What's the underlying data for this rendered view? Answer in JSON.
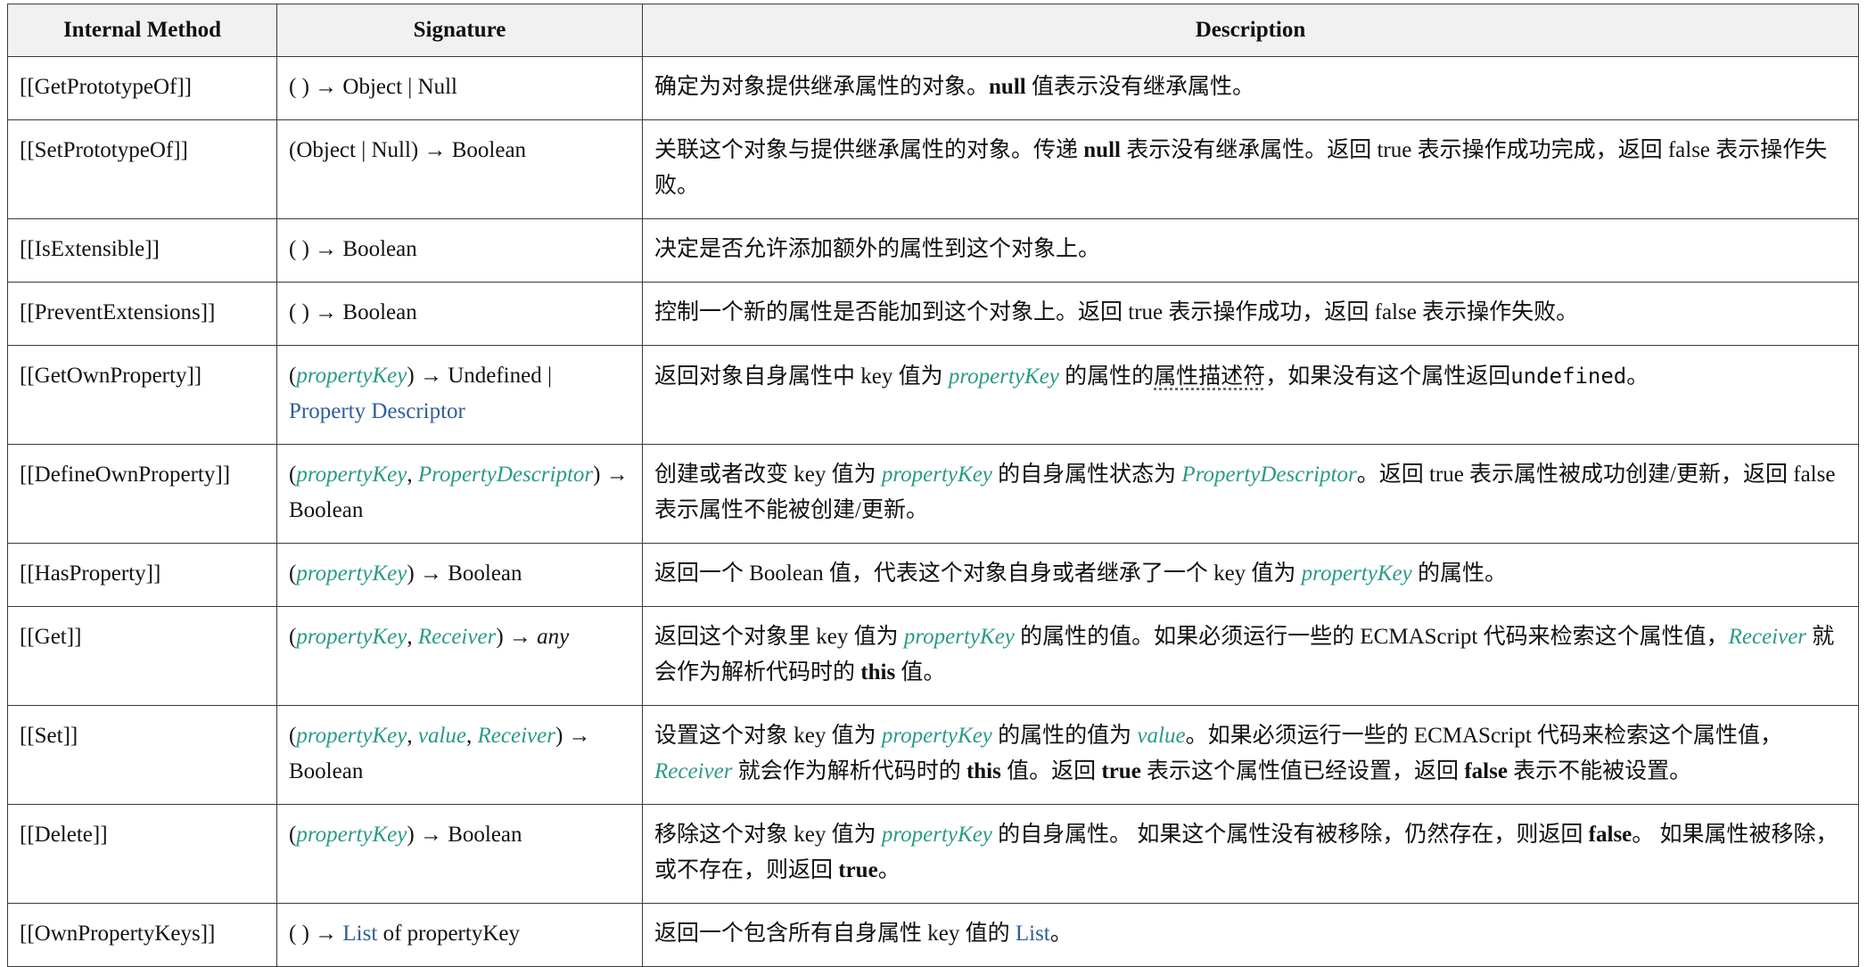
{
  "headers": {
    "method": "Internal Method",
    "signature": "Signature",
    "description": "Description"
  },
  "rows": [
    {
      "method": "[[GetPrototypeOf]]",
      "sig": [
        "( ) → Object | Null"
      ],
      "desc": [
        "确定为对象提供继承属性的对象。",
        "null",
        " 值表示没有继承属性。"
      ]
    },
    {
      "method": "[[SetPrototypeOf]]",
      "sig": [
        "(Object | Null) → Boolean"
      ],
      "desc": [
        "关联这个对象与提供继承属性的对象。传递 ",
        "null",
        " 表示没有继承属性。返回 true 表示操作成功完成，返回 false 表示操作失败。"
      ]
    },
    {
      "method": "[[IsExtensible]]",
      "sig": [
        "( ) → Boolean"
      ],
      "desc": [
        "决定是否允许添加额外的属性到这个对象上。"
      ]
    },
    {
      "method": "[[PreventExtensions]]",
      "sig": [
        "( ) → Boolean"
      ],
      "desc": [
        "控制一个新的属性是否能加到这个对象上。返回 true 表示操作成功，返回 false 表示操作失败。"
      ]
    },
    {
      "method": "[[GetOwnProperty]]",
      "sig": [
        "(",
        "propertyKey",
        ") → Undefined | ",
        "Property Descriptor"
      ],
      "desc": [
        "返回对象自身属性中 key 值为 ",
        "propertyKey",
        " 的属性的",
        "属性描述符",
        "，如果没有这个属性返回",
        "undefined",
        "。"
      ]
    },
    {
      "method": "[[DefineOwnProperty]]",
      "sig": [
        "(",
        "propertyKey",
        ", ",
        "PropertyDescriptor",
        ") → Boolean"
      ],
      "desc": [
        "创建或者改变 key 值为 ",
        "propertyKey",
        " 的自身属性状态为 ",
        "PropertyDescriptor",
        "。返回 true 表示属性被成功创建/更新，返回 false 表示属性不能被创建/更新。"
      ]
    },
    {
      "method": "[[HasProperty]]",
      "sig": [
        "(",
        "propertyKey",
        ") → Boolean"
      ],
      "desc": [
        "返回一个 Boolean 值，代表这个对象自身或者继承了一个 key 值为 ",
        "propertyKey",
        " 的属性。"
      ]
    },
    {
      "method": "[[Get]]",
      "sig": [
        "(",
        "propertyKey",
        ", ",
        "Receiver",
        ") → ",
        "any"
      ],
      "desc": [
        "返回这个对象里 key 值为 ",
        "propertyKey",
        " 的属性的值。如果必须运行一些的 ECMAScript 代码来检索这个属性值，",
        "Receiver",
        " 就会作为解析代码时的 ",
        "this",
        " 值。"
      ]
    },
    {
      "method": "[[Set]]",
      "sig": [
        "(",
        "propertyKey",
        ", ",
        "value",
        ", ",
        "Receiver",
        ") → Boolean"
      ],
      "desc": [
        "设置这个对象 key 值为 ",
        "propertyKey",
        " 的属性的值为 ",
        "value",
        "。如果必须运行一些的 ECMAScript 代码来检索这个属性值，",
        "Receiver",
        " 就会作为解析代码时的 ",
        "this",
        " 值。返回 ",
        "true",
        " 表示这个属性值已经设置，返回 ",
        "false",
        " 表示不能被设置。"
      ]
    },
    {
      "method": "[[Delete]]",
      "sig": [
        "(",
        "propertyKey",
        ") → Boolean"
      ],
      "desc": [
        "移除这个对象 key 值为 ",
        "propertyKey",
        " 的自身属性。 如果这个属性没有被移除，仍然存在，则返回 ",
        "false",
        "。 如果属性被移除，或不存在，则返回 ",
        "true",
        "。"
      ]
    },
    {
      "method": "[[OwnPropertyKeys]]",
      "sig": [
        "( ) → ",
        "List",
        " of propertyKey"
      ],
      "desc": [
        "返回一个包含所有自身属性 key 值的 ",
        "List",
        "。"
      ]
    }
  ]
}
